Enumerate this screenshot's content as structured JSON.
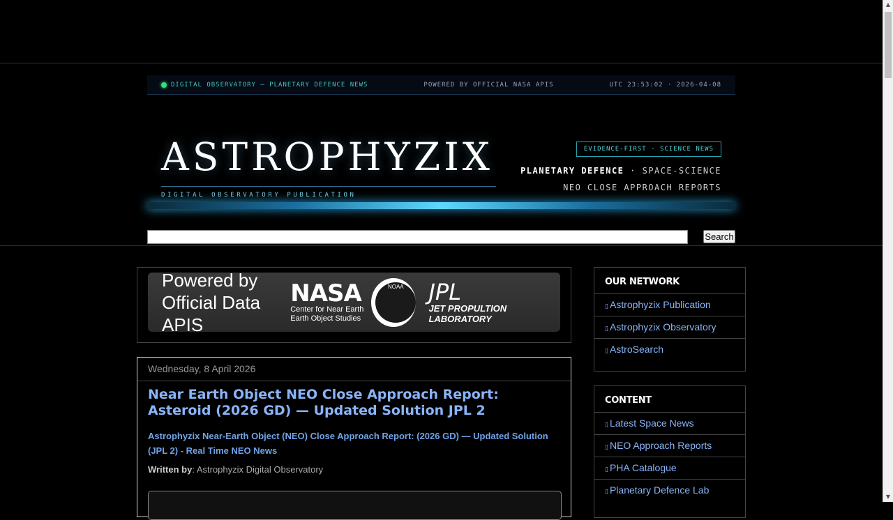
{
  "statusbar": {
    "left": "DIGITAL OBSERVATORY — PLANETARY DEFENCE NEWS",
    "center": "POWERED BY OFFICIAL NASA APIS",
    "right": "UTC 23:53:02 · 2026-04-08"
  },
  "masthead": {
    "logo": "ASTROPHYZIX",
    "logo_sub": "DIGITAL OBSERVATORY PUBLICATION",
    "badge": "EVIDENCE-FIRST · SCIENCE NEWS",
    "tag_bold": "PLANETARY DEFENCE",
    "tag_rest": " · SPACE-SCIENCE",
    "tag2": "NEO CLOSE APPROACH REPORTS"
  },
  "search": {
    "button_label": "Search",
    "value": ""
  },
  "banner": {
    "text": "Powered by Official Data APIS",
    "nasa": "NASA",
    "nasa_sub": "Center for Near Earth Earth Object Studies",
    "noaa": "NOAA",
    "jpl": "JPL",
    "jpl_sub": "JET PROPULTION LABORATORY"
  },
  "post": {
    "date": "Wednesday, 8 April 2026",
    "title": "Near Earth Object NEO Close Approach Report: Asteroid (2026 GD) — Updated Solution JPL 2",
    "subtitle": "Astrophyzix Near-Earth Object (NEO) Close Approach Report: (2026 GD) — Updated Solution (JPL 2) - Real Time NEO News",
    "author_label": "Written by",
    "author": ": Astrophyzix Digital Observatory"
  },
  "sidebar": {
    "network": {
      "title": "OUR NETWORK",
      "items": [
        "Astrophyzix Publication",
        "Astrophyzix Observatory",
        "AstroSearch"
      ]
    },
    "content": {
      "title": "CONTENT",
      "items": [
        "Latest Space News",
        "NEO Approach Reports",
        "PHA Catalogue",
        "Planetary Defence Lab"
      ]
    }
  },
  "colors": {
    "accent_cyan": "#4dd4d4",
    "link_blue": "#8ab4f8",
    "status_green": "#2ee07a"
  }
}
